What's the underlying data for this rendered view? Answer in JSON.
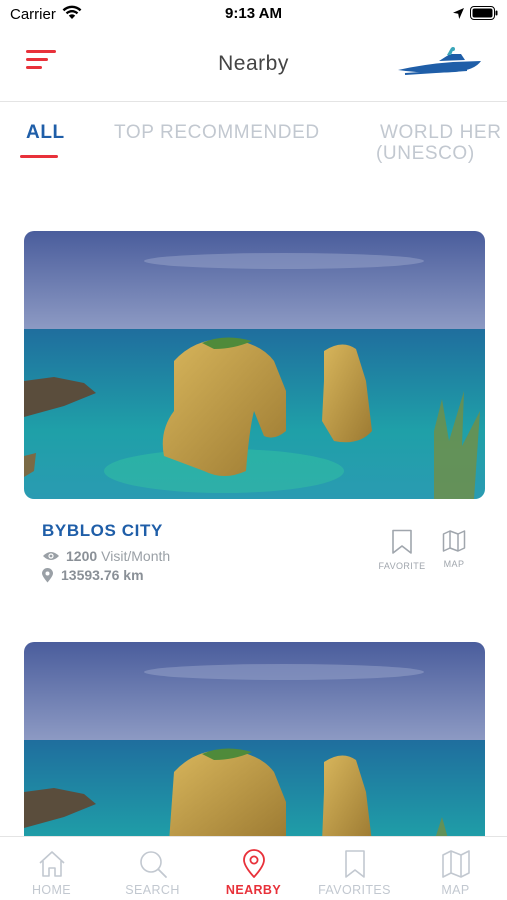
{
  "status_bar": {
    "carrier": "Carrier",
    "time": "9:13 AM"
  },
  "header": {
    "title": "Nearby",
    "menu_icon": "hamburger-menu-icon",
    "logo": "boat-logo"
  },
  "tabs": [
    {
      "label": "ALL",
      "active": true
    },
    {
      "label": "TOP RECOMMENDED",
      "active": false
    },
    {
      "label_line1": "WORLD HER",
      "label_line2": "(UNESCO)",
      "active": false
    }
  ],
  "cards": [
    {
      "title": "BYBLOS CITY",
      "visits_count": "1200",
      "visits_unit": "Visit/Month",
      "distance": "13593.76 km",
      "favorite_label": "FAVORITE",
      "map_label": "MAP"
    },
    {
      "title": "",
      "visits_count": "",
      "visits_unit": "",
      "distance": ""
    }
  ],
  "bottom_nav": [
    {
      "label": "HOME",
      "icon": "home-icon",
      "active": false
    },
    {
      "label": "SEARCH",
      "icon": "search-icon",
      "active": false
    },
    {
      "label": "NEARBY",
      "icon": "location-pin-icon",
      "active": true
    },
    {
      "label": "FAVORITES",
      "icon": "bookmark-icon",
      "active": false
    },
    {
      "label": "MAP",
      "icon": "map-icon",
      "active": false
    }
  ],
  "colors": {
    "accent_red": "#e8313a",
    "brand_blue": "#1f5ea8",
    "inactive_gray": "#c2c8d0"
  }
}
